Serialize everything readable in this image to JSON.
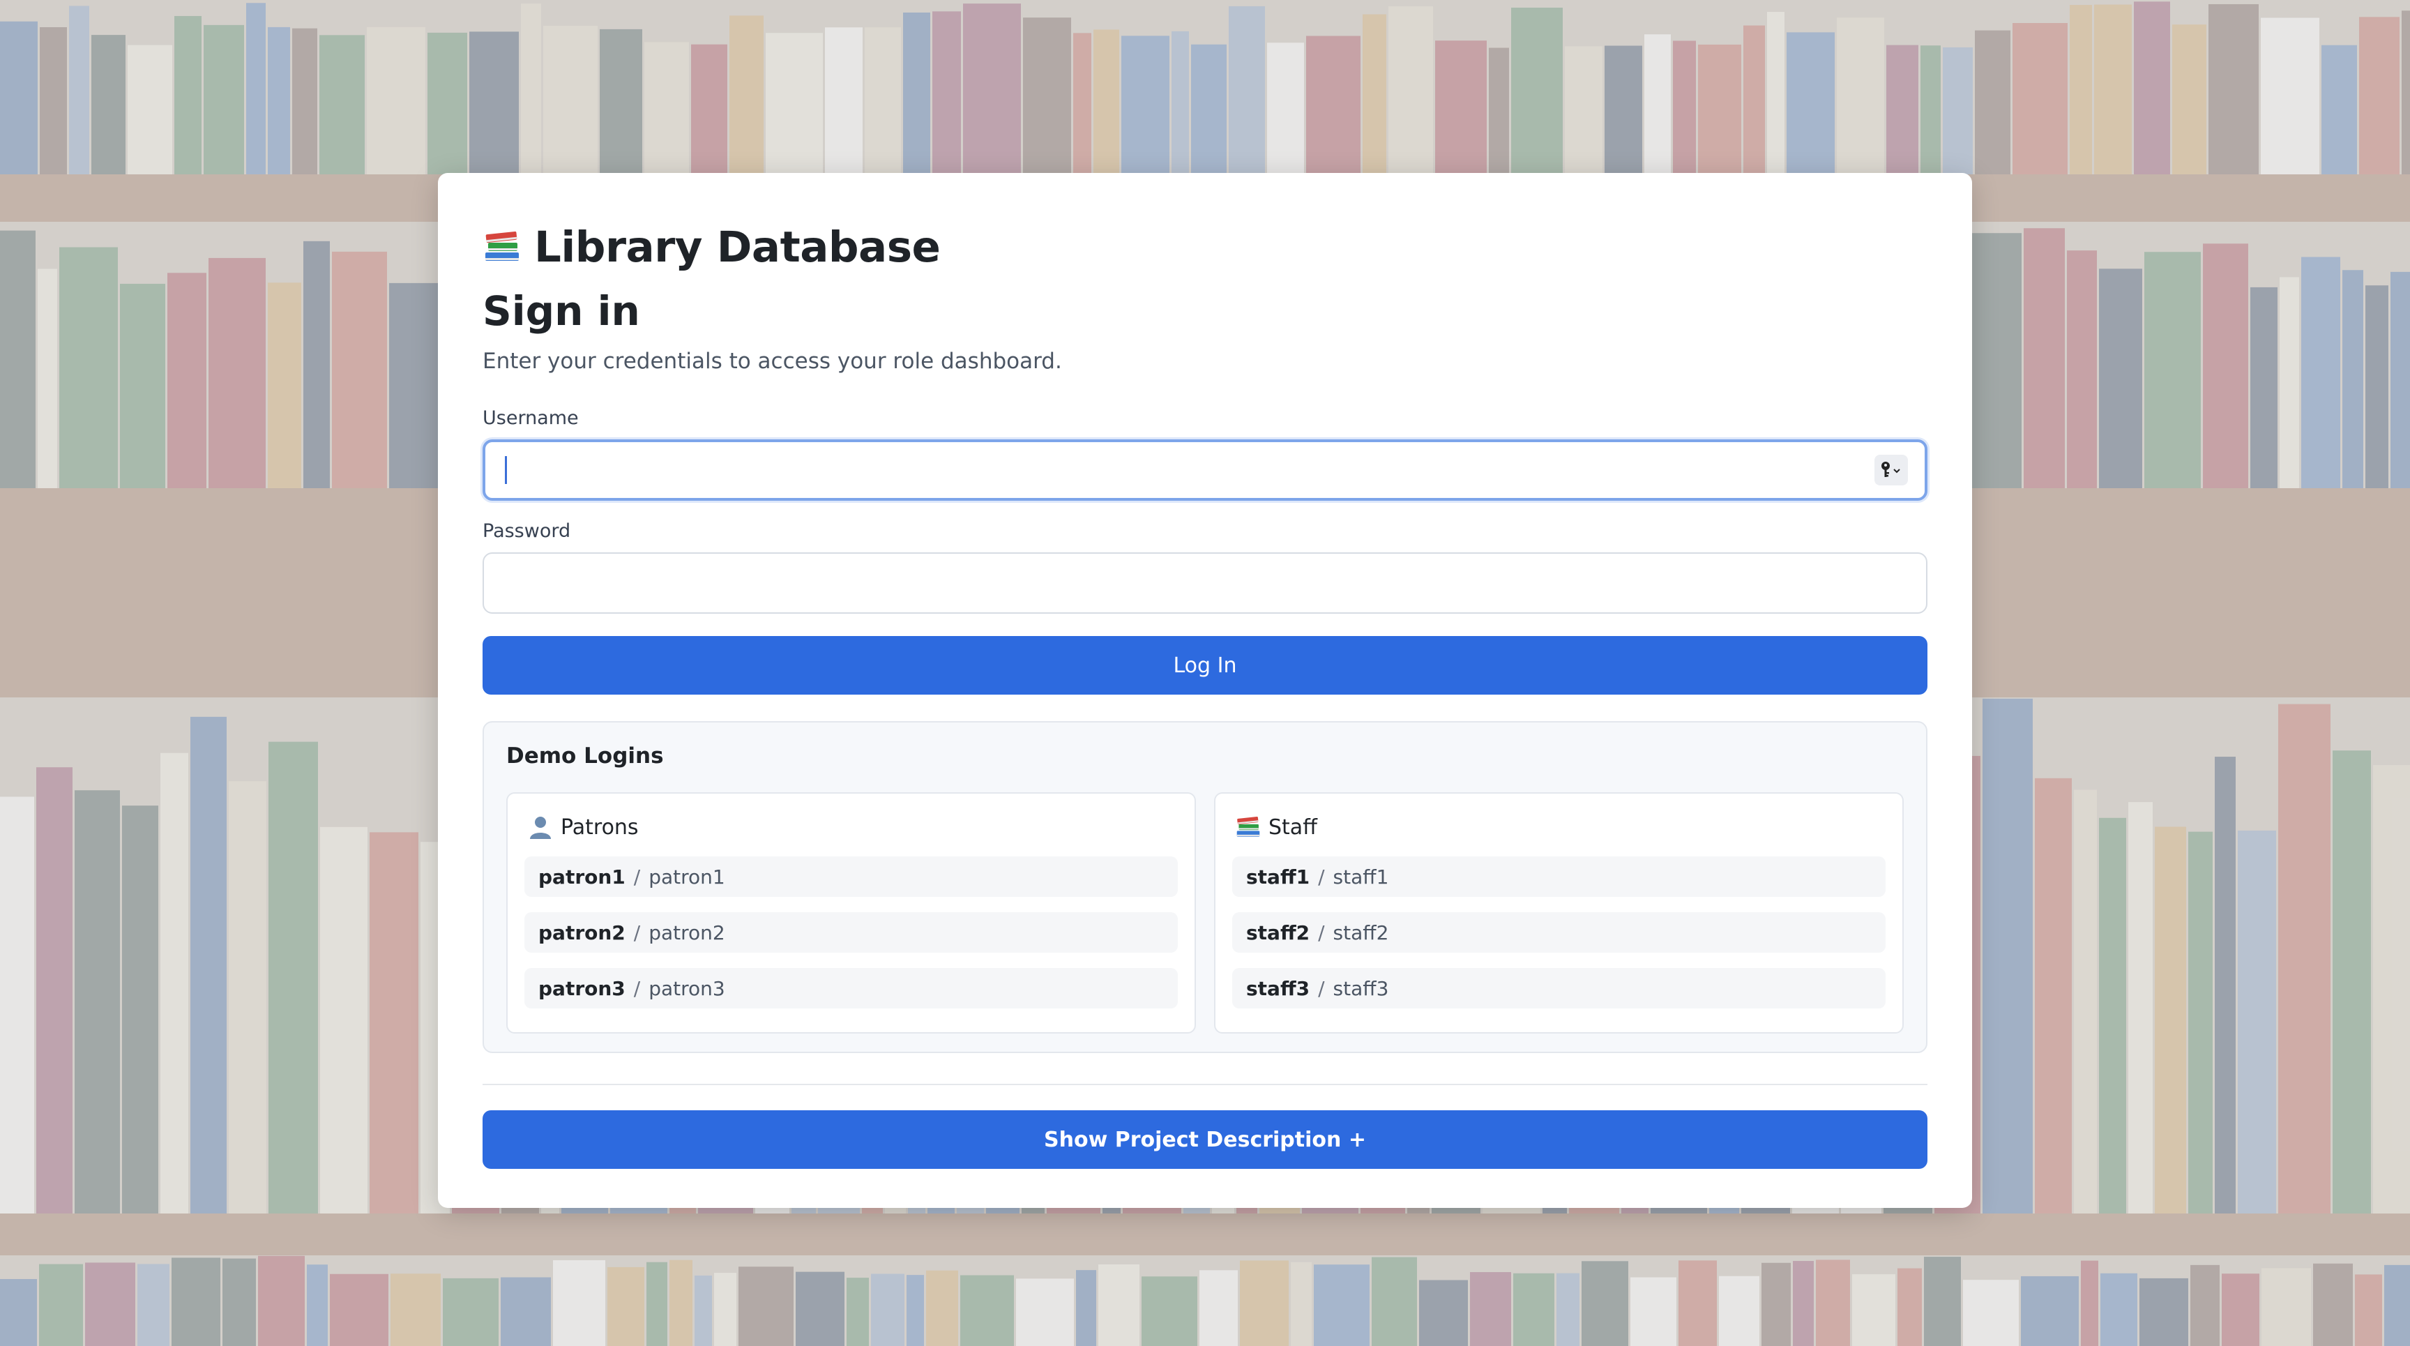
{
  "app": {
    "title": "Library Database",
    "brand_icon": "books-icon"
  },
  "signin": {
    "title": "Sign in",
    "subtitle": "Enter your credentials to access your role dashboard."
  },
  "form": {
    "username_label": "Username",
    "username_value": "",
    "password_label": "Password",
    "password_value": "",
    "login_label": "Log In"
  },
  "demo": {
    "title": "Demo Logins",
    "patrons": {
      "label": "Patrons",
      "icon": "person-icon",
      "accounts": [
        {
          "user": "patron1",
          "pass": "patron1"
        },
        {
          "user": "patron2",
          "pass": "patron2"
        },
        {
          "user": "patron3",
          "pass": "patron3"
        }
      ]
    },
    "staff": {
      "label": "Staff",
      "icon": "books-icon",
      "accounts": [
        {
          "user": "staff1",
          "pass": "staff1"
        },
        {
          "user": "staff2",
          "pass": "staff2"
        },
        {
          "user": "staff3",
          "pass": "staff3"
        }
      ]
    },
    "separator": "/"
  },
  "footer": {
    "show_description_label": "Show Project Description +"
  },
  "colors": {
    "primary": "#2d6adf",
    "focus_ring": "#7da5ea"
  }
}
